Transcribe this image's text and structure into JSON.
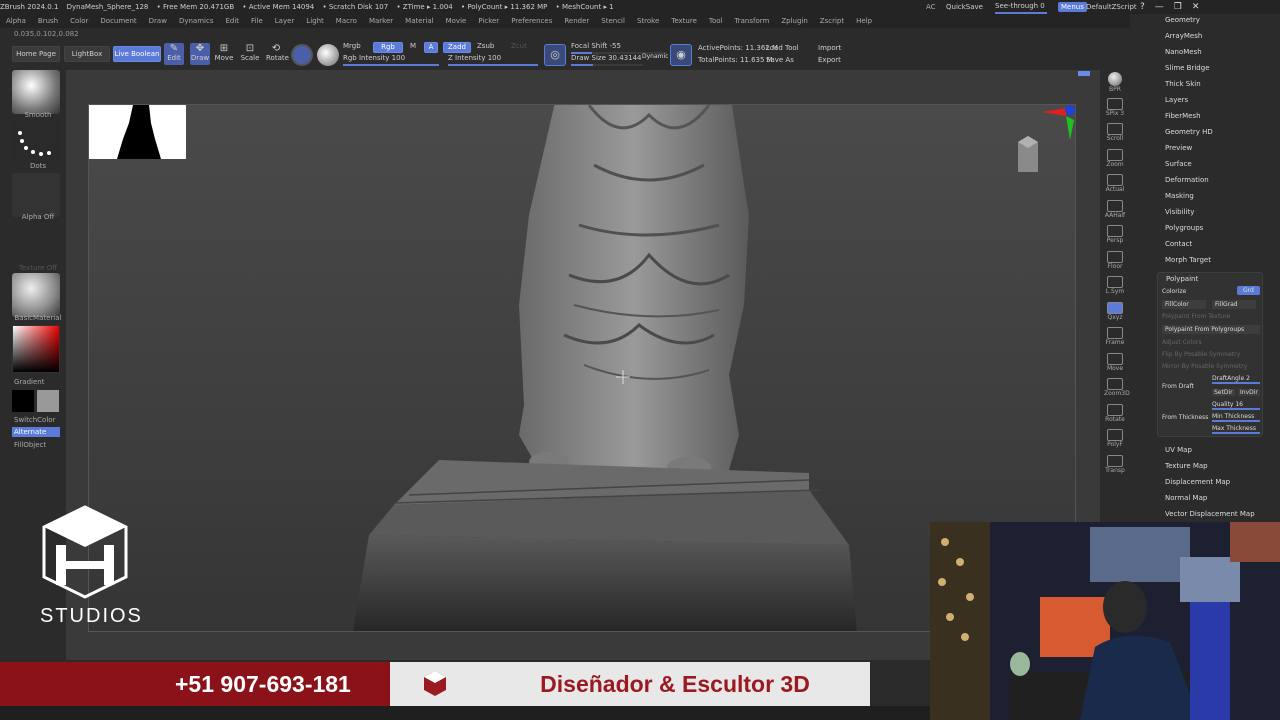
{
  "titlebar": {
    "app": "ZBrush 2024.0.1",
    "tool": "DynaMesh_Sphere_128",
    "free_mem": "• Free Mem 20.471GB",
    "active_mem": "• Active Mem 14094",
    "scratch": "• Scratch Disk 107",
    "ztime": "• ZTime ▸ 1.004",
    "polycount": "• PolyCount ▸ 11.362 MP",
    "meshcount": "• MeshCount ▸ 1",
    "ac": "AC",
    "quicksave": "QuickSave",
    "seethrough": "See-through  0",
    "menus": "Menus",
    "script": "DefaultZScript"
  },
  "menubar": [
    "Alpha",
    "Brush",
    "Color",
    "Document",
    "Draw",
    "Dynamics",
    "Edit",
    "File",
    "Layer",
    "Light",
    "Macro",
    "Marker",
    "Material",
    "Movie",
    "Picker",
    "Preferences",
    "Render",
    "Stencil",
    "Stroke",
    "Texture",
    "Tool",
    "Transform",
    "Zplugin",
    "Zscript",
    "Help"
  ],
  "coords": "0.035,0.102,0.082",
  "shelf": {
    "home": "Home Page",
    "lightbox": "LightBox",
    "liveboolean": "Live Boolean",
    "edit": "Edit",
    "draw": "Draw",
    "move": "Move",
    "scale": "Scale",
    "rotate": "Rotate",
    "mrgb": "Mrgb",
    "rgb": "Rgb",
    "m": "M",
    "a": "A",
    "zadd": "Zadd",
    "zsub": "Zsub",
    "zcut": "Zcut",
    "rgb_intensity": "Rgb Intensity 100",
    "z_intensity": "Z Intensity 100",
    "focal_shift": "Focal Shift -55",
    "draw_size": "Draw Size 30.43144",
    "dynamic": "Dynamic",
    "active_points": "ActivePoints: 11.362 M",
    "total_points": "TotalPoints: 11.635 M",
    "load_tool": "Load Tool",
    "save_as": "Save As",
    "import": "Import",
    "export": "Export"
  },
  "left": {
    "smooth": "Smooth",
    "dots": "Dots",
    "alpha_off": "Alpha Off",
    "texture_off": "Texture Off",
    "material": "BasicMaterial",
    "gradient": "Gradient",
    "switchcolor": "SwitchColor",
    "alternate": "Alternate",
    "fillobject": "FillObject"
  },
  "rightshelf": [
    "BPR",
    "SPix 3",
    "Scroll",
    "Zoom",
    "Actual",
    "AAHalf",
    "Persp",
    "Floor",
    "L.Sym",
    "Qxyz",
    "Frame",
    "Move",
    "Zoom3D",
    "Rotate",
    "PolyF",
    "Transp"
  ],
  "tray": [
    "Geometry",
    "ArrayMesh",
    "NanoMesh",
    "Slime Bridge",
    "Thick Skin",
    "Layers",
    "FiberMesh",
    "Geometry HD",
    "Preview",
    "Surface",
    "Deformation",
    "Masking",
    "Visibility",
    "Polygroups",
    "Contact",
    "Morph Target"
  ],
  "tray_bottom": [
    "UV Map",
    "Texture Map",
    "Displacement Map",
    "Normal Map",
    "Vector Displacement Map"
  ],
  "polypaint": {
    "title": "Polypaint",
    "colorize": "Colorize",
    "grd": "Grd",
    "fillcolor": "FillColor",
    "fillgrad": "FillGrad",
    "from_texture": "Polypaint From Texture",
    "from_polygroups": "Polypaint From Polygroups",
    "adjust_colors": "Adjust Colors",
    "flip_sym": "Flip By Posable Symmetry",
    "mirror_sym": "Mirror By Posable Symmetry",
    "from_draft": "From Draft",
    "draftangle": "DraftAngle 2",
    "setdir": "SetDir",
    "invdir": "InvDir",
    "from_thickness": "From Thickness",
    "quality": "Quality 16",
    "min_thickness": "Min Thickness",
    "max_thickness": "Max Thickness"
  },
  "overlay": {
    "phone": "+51 907-693-181",
    "title": "Diseñador & Escultor 3D",
    "studios": "STUDIOS"
  },
  "colors": {
    "accent": "#5a7bd8",
    "banner": "#8b1219"
  }
}
